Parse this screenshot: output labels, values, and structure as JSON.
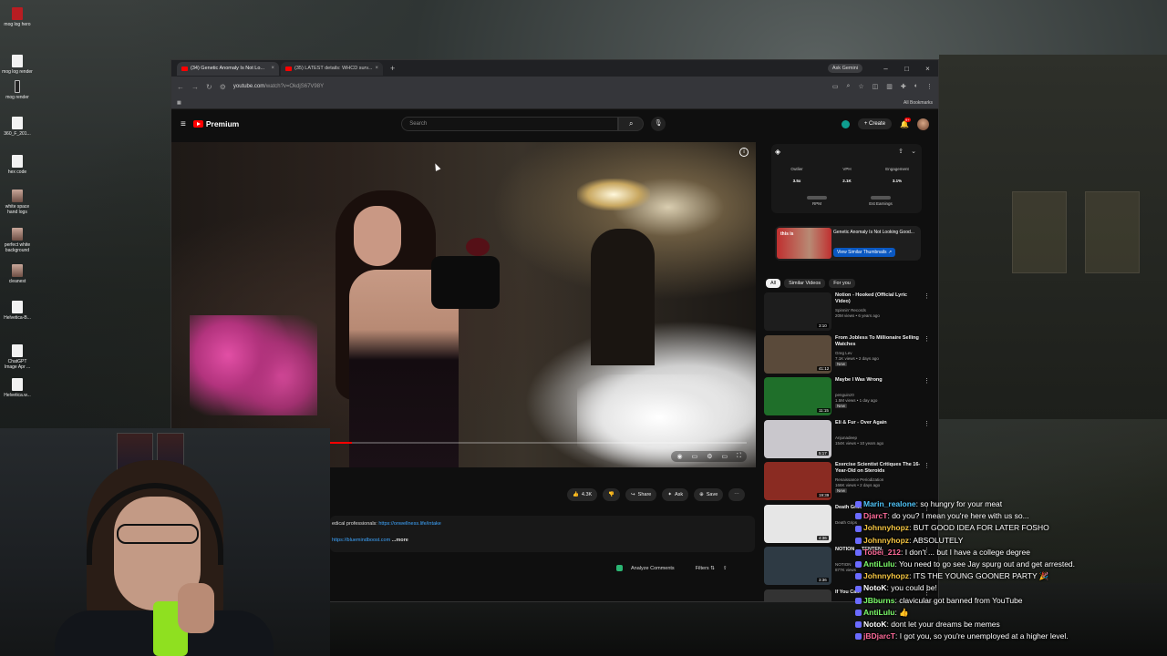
{
  "desktop": {
    "icons": [
      {
        "label": "mog log hero",
        "type": "red"
      },
      {
        "label": "mog log render",
        "type": "file"
      },
      {
        "label": "mog render",
        "type": "dark"
      },
      {
        "label": "360_F_201...",
        "type": "file"
      },
      {
        "label": "hex code",
        "type": "file"
      },
      {
        "label": "white space hand logs",
        "type": "img"
      },
      {
        "label": "perfect white background",
        "type": "img"
      },
      {
        "label": "cleanest",
        "type": "img"
      },
      {
        "label": "Helvetica-B...",
        "type": "file"
      },
      {
        "label": "ChatGPT Image Apr ...",
        "type": "file"
      },
      {
        "label": "Helvetica.w...",
        "type": "file"
      }
    ]
  },
  "browser": {
    "tabs": [
      {
        "title": "(34) Genetic Anomaly Is Not Lo...",
        "active": true
      },
      {
        "title": "(35) LATEST details: WHCD surv...",
        "active": false
      }
    ],
    "gemini": "Ask Gemini",
    "url_host": "youtube.com",
    "url_path": "/watch?v=OkdjS67V98Y",
    "bookmarks_label": "All Bookmarks"
  },
  "youtube": {
    "logo_text": "Premium",
    "search_placeholder": "Search",
    "create_label": "Create",
    "bell_badge": "9+",
    "player": {
      "progress": 0.06
    },
    "actions": {
      "likes": "4.3K",
      "share": "Share",
      "ask": "Ask",
      "save": "Save"
    },
    "description": {
      "line1_text": "edical professionals:",
      "line1_link": "https://onwellness.life/intake",
      "line2_link": "https://bluemindboost.com",
      "more": "...more"
    },
    "comments": {
      "analyze": "Analyze Comments",
      "filters": "Filters"
    }
  },
  "vidiq": {
    "stats": [
      {
        "label": "Outlier",
        "value": "3.5x"
      },
      {
        "label": "VPH",
        "value": "2.1K"
      },
      {
        "label": "Engagement",
        "value": "3.1%"
      }
    ],
    "hidden": [
      {
        "label": "RPM"
      },
      {
        "label": "Est Earnings"
      }
    ],
    "thumb_text": "this is",
    "thumb_title": "Genetic Anomaly Is Not Looking Good...",
    "similar_button": "View Similar Thumbnails"
  },
  "sidebar": {
    "chips": [
      {
        "label": "All",
        "on": true
      },
      {
        "label": "Similar Videos",
        "on": false
      },
      {
        "label": "For you",
        "on": false
      }
    ],
    "videos": [
      {
        "title": "Notion - Hooked (Official Lyric Video)",
        "channel": "Spinnin' Records",
        "meta": "20M views • 6 years ago",
        "duration": "3:10",
        "color": "#1d1d1d"
      },
      {
        "title": "From Jobless To Millionaire Selling Watches",
        "channel": "Greg Lev",
        "meta": "7.1K views • 2 days ago",
        "badge": "New",
        "duration": "41:12",
        "color": "#5a4a3a"
      },
      {
        "title": "Maybe I Was Wrong",
        "channel": "penguinz0",
        "meta": "1.5M views • 1 day ago",
        "badge": "New",
        "duration": "11:15",
        "color": "#1f6f2a"
      },
      {
        "title": "Eli & Fur - Over Again",
        "channel": "Anjunadeep",
        "meta": "154K views • 10 years ago",
        "duration": "5:17",
        "color": "#c9c7cc"
      },
      {
        "title": "Exercise Scientist Critiques The 16-Year-Old on Steroids",
        "channel": "Renaissance Periodization",
        "meta": "166K views • 2 days ago",
        "badge": "New",
        "duration": "19:39",
        "color": "#8a2b22"
      },
      {
        "title": "Death Gri...",
        "channel": "Death Grips",
        "meta": "",
        "duration": "4:36",
        "color": "#e6e6e6"
      },
      {
        "title": "NOTION ... TENTEN",
        "channel": "NOTION",
        "meta": "877K views",
        "duration": "3:36",
        "color": "#2e3a44"
      },
      {
        "title": "If You Ca...",
        "channel": "",
        "meta": "",
        "duration": "",
        "color": "#333"
      }
    ]
  },
  "chat": [
    {
      "user": "Marin_realone",
      "text": "so hungry for your meat",
      "color": "#4fc3f7"
    },
    {
      "user": "DjarcT",
      "text": "do you? I mean you're here with us so...",
      "color": "#ff6b9a"
    },
    {
      "user": "Johnnyhopz",
      "text": "BUT GOOD IDEA FOR LATER FOSHO",
      "color": "#f4c542"
    },
    {
      "user": "Johnnyhopz",
      "text": "ABSOLUTELY",
      "color": "#f4c542"
    },
    {
      "user": "Tobei_212",
      "text": "I don't ... but I have a college degree",
      "color": "#ff6b9a"
    },
    {
      "user": "AntiLulu",
      "text": "You need to go see Jay spurg out and get arrested.",
      "color": "#7cfc6a"
    },
    {
      "user": "Johnnyhopz",
      "text": "ITS THE YOUNG GOONER PARTY 🎉",
      "color": "#f4c542"
    },
    {
      "user": "NotoK",
      "text": "you could be!",
      "color": "#ffffff"
    },
    {
      "user": "JBburns",
      "text": "clavicular got banned from YouTube",
      "color": "#7cfc6a"
    },
    {
      "user": "AntiLulu",
      "text": "👍",
      "color": "#7cfc6a"
    },
    {
      "user": "NotoK",
      "text": "dont let your dreams be memes",
      "color": "#ffffff"
    },
    {
      "user": "jBDjarcT",
      "text": "I got you, so you're unemployed at a higher level.",
      "color": "#ff6b9a"
    }
  ]
}
